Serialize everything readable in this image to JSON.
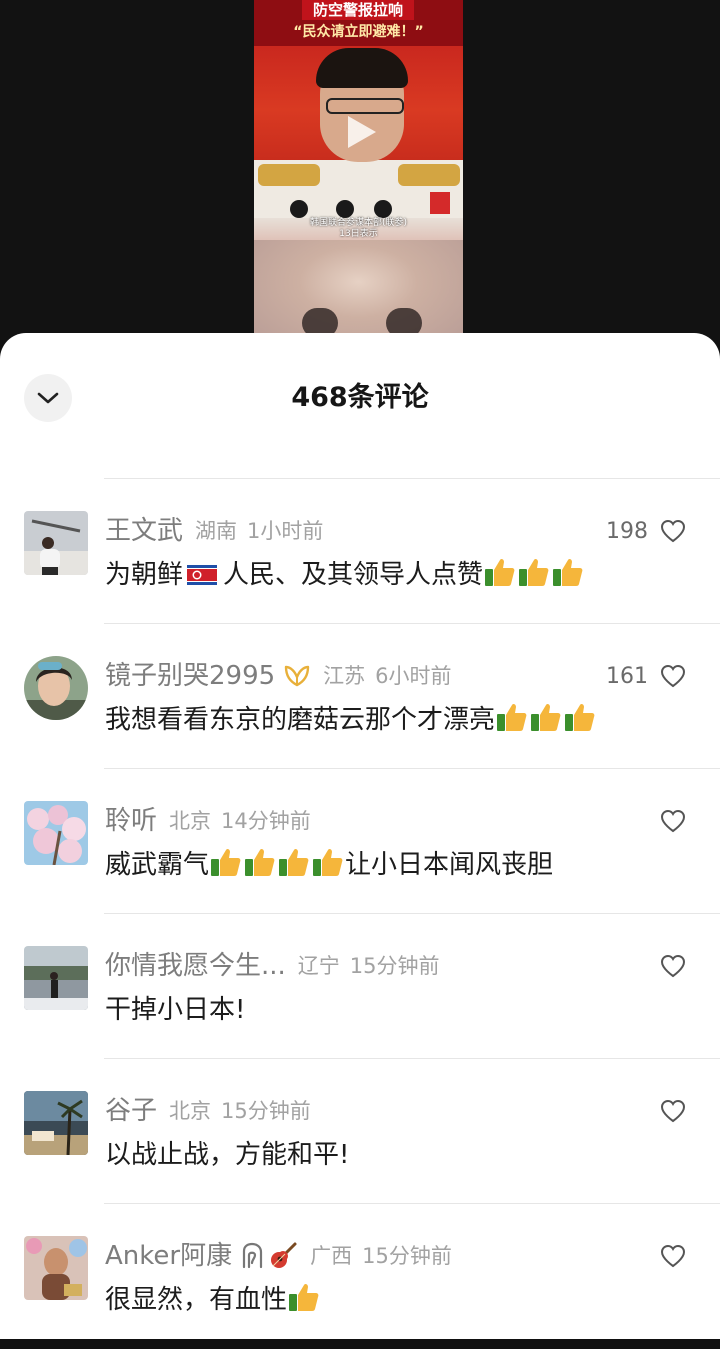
{
  "video": {
    "banner_line1": "防空警报拉响",
    "banner_line2": "“民众请立即避难！”",
    "caption_line1": "韩国联合参谋本部(联参)",
    "caption_line2": "13日表示",
    "icon": "play-icon"
  },
  "header": {
    "title": "468条评论",
    "collapse_icon": "chevron-down-icon"
  },
  "comments": [
    {
      "username": "王文武",
      "location": "湖南",
      "time": "1小时前",
      "likes": "198",
      "text_parts": [
        "为朝鲜",
        "人民、及其领导人点赞"
      ],
      "emojis": [
        "north-korea-flag",
        "thumbs-up",
        "thumbs-up",
        "thumbs-up"
      ]
    },
    {
      "username": "镜子别哭2995",
      "location": "江苏",
      "time": "6小时前",
      "likes": "161",
      "text": "我想看看东京的磨菇云那个才漂亮",
      "badge": "ribbon-badge-icon",
      "emojis": [
        "thumbs-up",
        "thumbs-up",
        "thumbs-up"
      ]
    },
    {
      "username": "聆听",
      "location": "北京",
      "time": "14分钟前",
      "likes": "",
      "text_parts": [
        "威武霸气",
        "让小日本闻风丧胆"
      ],
      "emojis": [
        "thumbs-up",
        "thumbs-up",
        "thumbs-up",
        "thumbs-up"
      ]
    },
    {
      "username": "你情我愿今生...",
      "location": "辽宁",
      "time": "15分钟前",
      "likes": "",
      "text": "干掉小日本!"
    },
    {
      "username": "谷子",
      "location": "北京",
      "time": "15分钟前",
      "likes": "",
      "text": "以战止战，方能和平!"
    },
    {
      "username": "Anker阿康",
      "location": "广西",
      "time": "15分钟前",
      "likes": "",
      "text": "很显然，有血性",
      "emojis": [
        "thai-script-glyph",
        "guitar",
        "thumbs-up"
      ]
    }
  ],
  "colors": {
    "sheet_bg": "#ffffff",
    "username": "#7d7d7d",
    "meta": "#a2a2a2",
    "text": "#1c1c1c",
    "badge_gold": "#e8b03a"
  }
}
